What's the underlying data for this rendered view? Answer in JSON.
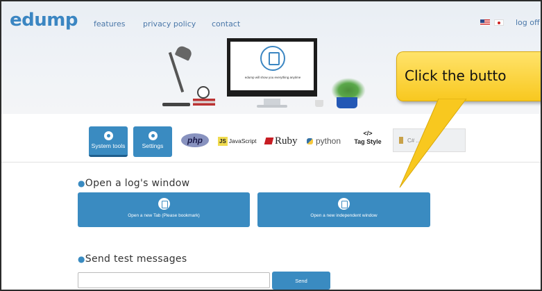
{
  "header": {
    "logo": "edump",
    "nav": [
      "features",
      "privacy policy",
      "contact"
    ],
    "logoff": "log off",
    "monitor_caption": "edump will show you everything anytime"
  },
  "toolbar": {
    "system_tools": "System tools",
    "settings": "Settings",
    "php": "php",
    "js_badge": "JS",
    "js_text": "JavaScript",
    "ruby": "Ruby",
    "python": "python",
    "tag_icon": "</>",
    "tag_style": "Tag Style",
    "csh_text": "C# ... H"
  },
  "log_window": {
    "title": "Open a log's window",
    "tab_button": "Open a new Tab (Please bookmark)",
    "window_button": "Open a new independent window"
  },
  "test_messages": {
    "title": "Send test messages",
    "input_value": "",
    "send_label": "Send"
  },
  "callout": {
    "text": "Click the butto",
    "color": "#f8c81f"
  },
  "colors": {
    "accent": "#3a8bc1",
    "logo": "#3b86c2"
  },
  "icons": [
    "gear-icon",
    "user-icon",
    "document-icon"
  ]
}
